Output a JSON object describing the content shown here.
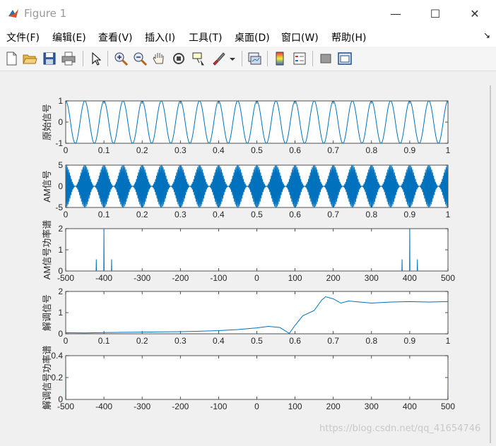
{
  "window": {
    "title": "Figure 1",
    "minimize": "—",
    "maximize": "☐",
    "close": "✕"
  },
  "menu": {
    "items": [
      "文件(F)",
      "编辑(E)",
      "查看(V)",
      "插入(I)",
      "工具(T)",
      "桌面(D)",
      "窗口(W)",
      "帮助(H)"
    ],
    "arrow": "↘"
  },
  "toolbar": {
    "buttons": [
      "new-figure-icon",
      "open-file-icon",
      "save-icon",
      "print-icon",
      "select-arrow-icon",
      "zoom-in-icon",
      "zoom-out-icon",
      "pan-hand-icon",
      "rotate-3d-icon",
      "data-cursor-icon",
      "brush-icon",
      "brush-dropdown-icon",
      "link-plot-icon",
      "colorbar-icon",
      "legend-icon",
      "hide-plot-tools-icon",
      "show-plot-tools-icon"
    ]
  },
  "watermark": "https://blog.csdn.net/qq_41654746",
  "chart_data": [
    {
      "type": "line",
      "ylabel": "原始信号",
      "xlim": [
        0,
        1
      ],
      "ylim": [
        -1,
        1
      ],
      "xticks": [
        "0",
        "0.1",
        "0.2",
        "0.3",
        "0.4",
        "0.5",
        "0.6",
        "0.7",
        "0.8",
        "0.9",
        "1"
      ],
      "yticks": [
        "-1",
        "0",
        "1"
      ],
      "series": [
        {
          "signal": "cos",
          "amplitude": 1,
          "frequency_hz": 20,
          "color": "#0072bd"
        }
      ]
    },
    {
      "type": "line",
      "ylabel": "AM信号",
      "xlim": [
        0,
        1
      ],
      "ylim": [
        -5,
        5
      ],
      "xticks": [
        "0",
        "0.1",
        "0.2",
        "0.3",
        "0.4",
        "0.5",
        "0.6",
        "0.7",
        "0.8",
        "0.9",
        "1"
      ],
      "yticks": [
        "-5",
        "0",
        "5"
      ],
      "series": [
        {
          "signal": "am",
          "carrier_hz": 400,
          "message_hz": 20,
          "amplitude": 5,
          "color": "#0072bd"
        }
      ]
    },
    {
      "type": "line",
      "ylabel": "AM信号功率谱",
      "xlim": [
        -500,
        500
      ],
      "ylim": [
        0,
        2
      ],
      "xticks": [
        "-500",
        "-400",
        "-300",
        "-200",
        "-100",
        "0",
        "100",
        "200",
        "300",
        "400",
        "500"
      ],
      "yticks": [
        "0",
        "1",
        "2"
      ],
      "series": [
        {
          "spikes": [
            [
              -420,
              0.55
            ],
            [
              -400,
              2.1
            ],
            [
              -380,
              0.55
            ],
            [
              380,
              0.55
            ],
            [
              400,
              2.1
            ],
            [
              420,
              0.55
            ]
          ],
          "color": "#0072bd"
        }
      ]
    },
    {
      "type": "line",
      "ylabel": "解调信号",
      "xlim": [
        0,
        1
      ],
      "ylim": [
        0,
        2
      ],
      "xticks": [
        "0",
        "0.1",
        "0.2",
        "0.3",
        "0.4",
        "0.5",
        "0.6",
        "0.7",
        "0.8",
        "0.9",
        "1"
      ],
      "yticks": [
        "0",
        "1",
        "2"
      ],
      "series": [
        {
          "points": [
            [
              0,
              0.05
            ],
            [
              0.05,
              0.04
            ],
            [
              0.1,
              0.06
            ],
            [
              0.15,
              0.07
            ],
            [
              0.2,
              0.08
            ],
            [
              0.25,
              0.09
            ],
            [
              0.3,
              0.1
            ],
            [
              0.35,
              0.12
            ],
            [
              0.4,
              0.15
            ],
            [
              0.45,
              0.2
            ],
            [
              0.5,
              0.28
            ],
            [
              0.53,
              0.35
            ],
            [
              0.56,
              0.3
            ],
            [
              0.585,
              0.02
            ],
            [
              0.6,
              0.4
            ],
            [
              0.62,
              0.85
            ],
            [
              0.65,
              1.1
            ],
            [
              0.67,
              1.6
            ],
            [
              0.68,
              1.75
            ],
            [
              0.7,
              1.65
            ],
            [
              0.72,
              1.45
            ],
            [
              0.74,
              1.55
            ],
            [
              0.77,
              1.5
            ],
            [
              0.8,
              1.45
            ],
            [
              0.85,
              1.5
            ],
            [
              0.9,
              1.52
            ],
            [
              0.95,
              1.5
            ],
            [
              1,
              1.52
            ]
          ],
          "color": "#0072bd"
        }
      ]
    },
    {
      "type": "line",
      "ylabel": "解调信号功率谱",
      "xlim": [
        -500,
        500
      ],
      "ylim": [
        0,
        0.4
      ],
      "xticks": [
        "-500",
        "-400",
        "-300",
        "-200",
        "-100",
        "0",
        "100",
        "200",
        "300",
        "400",
        "500"
      ],
      "yticks": [
        "0",
        "0.2",
        "0.4"
      ],
      "series": [
        {
          "spikes": [
            [
              -500,
              0.4
            ],
            [
              500,
              0.12
            ]
          ],
          "color": "#0072bd"
        }
      ]
    }
  ]
}
